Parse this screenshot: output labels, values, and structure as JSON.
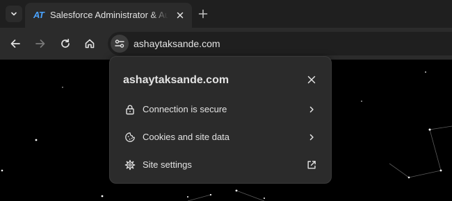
{
  "tabstrip": {
    "tab": {
      "favicon_text": "AT",
      "title": "Salesforce Administrator & Automation"
    },
    "icons": {
      "tab_search": "chevron-down-icon",
      "tab_close": "close-icon",
      "new_tab": "plus-icon"
    }
  },
  "toolbar": {
    "icons": [
      "back-arrow-icon",
      "forward-arrow-icon",
      "reload-icon",
      "home-icon",
      "tune-icon"
    ],
    "url": "ashaytaksande.com"
  },
  "site_info_popup": {
    "title": "ashaytaksande.com",
    "items": [
      {
        "label": "Connection is secure",
        "icon": "lock-icon",
        "trailing_icon": "chevron-right-icon"
      },
      {
        "label": "Cookies and site data",
        "icon": "cookie-icon",
        "trailing_icon": "chevron-right-icon"
      },
      {
        "label": "Site settings",
        "icon": "gear-icon",
        "trailing_icon": "open-external-icon"
      }
    ]
  },
  "colors": {
    "tabstrip_bg": "#1f1f1f",
    "toolbar_bg": "#2b2b2b",
    "popup_bg": "#2b2b2b",
    "favicon": "#4aa3ff",
    "text": "#e3e3e3",
    "page_bg": "#000000"
  }
}
